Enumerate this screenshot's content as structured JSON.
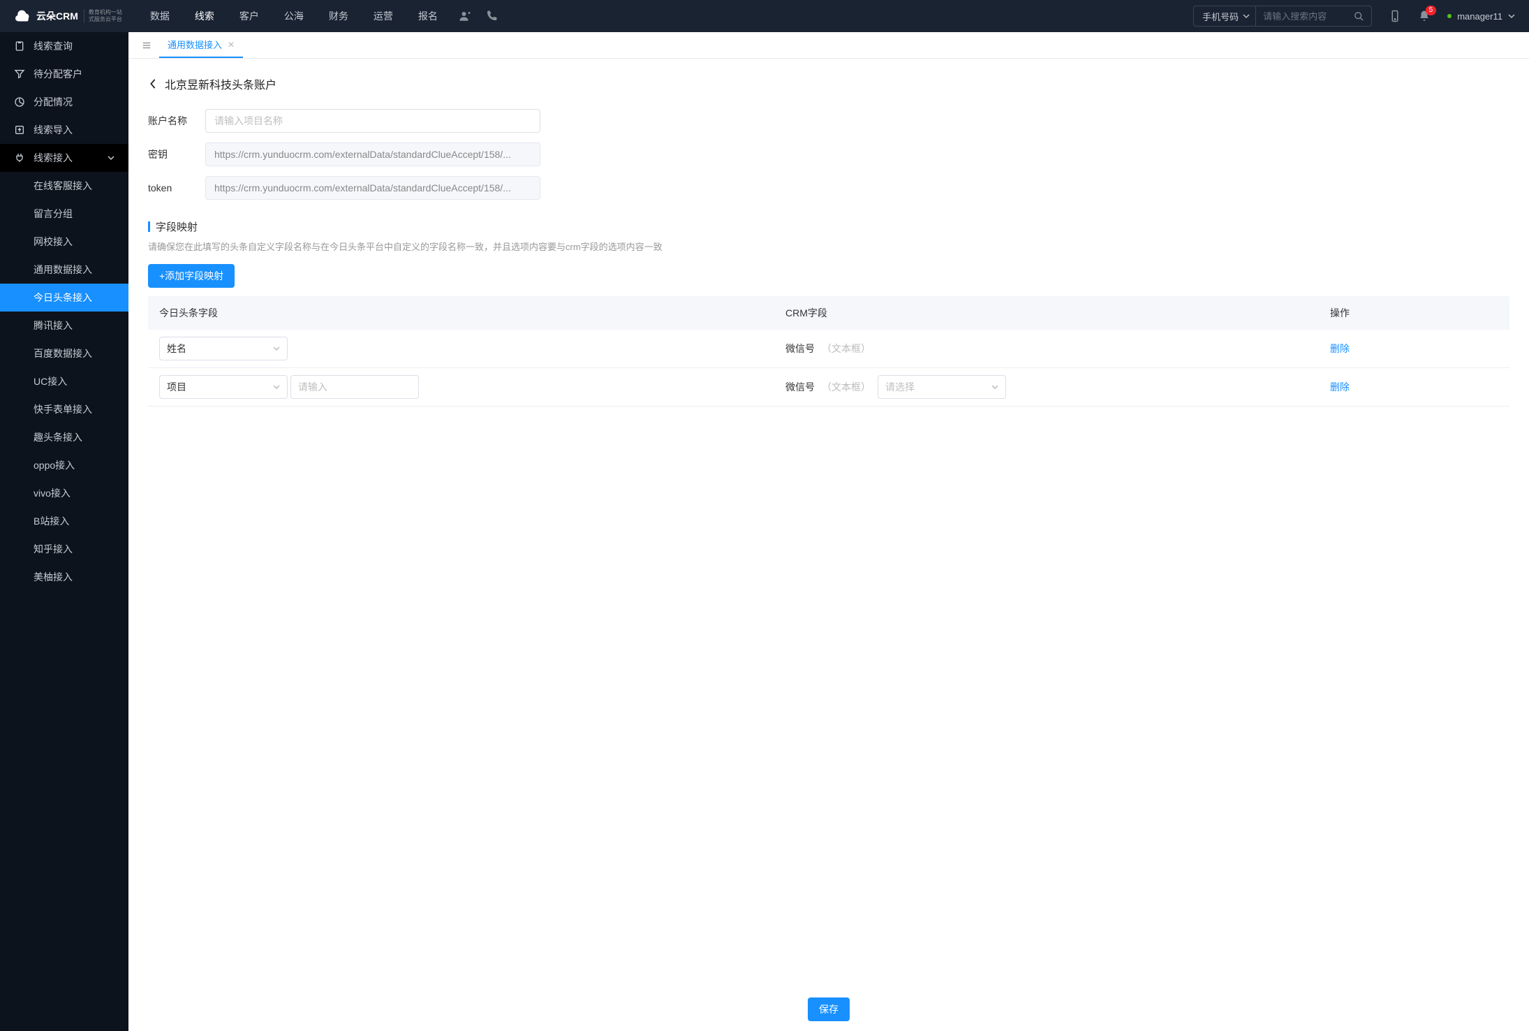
{
  "header": {
    "logo_main": "云朵CRM",
    "logo_sub1": "教育机构一站",
    "logo_sub2": "式服务云平台",
    "nav": [
      "数据",
      "线索",
      "客户",
      "公海",
      "财务",
      "运营",
      "报名"
    ],
    "nav_active": 1,
    "search_select": "手机号码",
    "search_placeholder": "请输入搜索内容",
    "notif_count": "5",
    "user": "manager11"
  },
  "sidebar": {
    "items": [
      {
        "label": "线索查询",
        "icon": "clipboard"
      },
      {
        "label": "待分配客户",
        "icon": "filter"
      },
      {
        "label": "分配情况",
        "icon": "pie"
      },
      {
        "label": "线索导入",
        "icon": "upload"
      },
      {
        "label": "线索接入",
        "icon": "plug",
        "expanded": true
      }
    ],
    "subs": [
      "在线客服接入",
      "留言分组",
      "网校接入",
      "通用数据接入",
      "今日头条接入",
      "腾讯接入",
      "百度数据接入",
      "UC接入",
      "快手表单接入",
      "趣头条接入",
      "oppo接入",
      "vivo接入",
      "B站接入",
      "知乎接入",
      "美柚接入"
    ],
    "sub_active": 4
  },
  "tabs": {
    "items": [
      {
        "label": "通用数据接入"
      }
    ],
    "active": 0
  },
  "page": {
    "title": "北京昱新科技头条账户",
    "form": {
      "account_label": "账户名称",
      "account_placeholder": "请输入项目名称",
      "secret_label": "密钥",
      "secret_value": "https://crm.yunduocrm.com/externalData/standardClueAccept/158/...",
      "token_label": "token",
      "token_value": "https://crm.yunduocrm.com/externalData/standardClueAccept/158/..."
    },
    "section_title": "字段映射",
    "section_desc": "请确保您在此填写的头条自定义字段名称与在今日头条平台中自定义的字段名称一致，并且选项内容要与crm字段的选项内容一致",
    "add_button": "+添加字段映射",
    "table": {
      "headers": [
        "今日头条字段",
        "CRM字段",
        "操作"
      ],
      "rows": [
        {
          "toutiao_select": "姓名",
          "crm_label": "微信号",
          "crm_type": "（文本框）",
          "action": "删除",
          "has_extra_input": false,
          "has_crm_select": false
        },
        {
          "toutiao_select": "项目",
          "extra_input_placeholder": "请输入",
          "crm_label": "微信号",
          "crm_type": "（文本框）",
          "crm_select_placeholder": "请选择",
          "action": "删除",
          "has_extra_input": true,
          "has_crm_select": true
        }
      ]
    },
    "save_button": "保存"
  }
}
